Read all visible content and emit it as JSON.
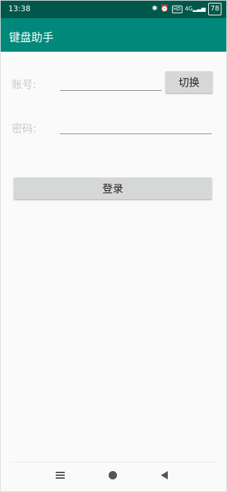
{
  "status_bar": {
    "time": "13:38",
    "icons": [
      "bluetooth-icon",
      "alarm-icon",
      "hd-icon",
      "signal-4g-icon"
    ],
    "battery": "78"
  },
  "app_bar": {
    "title": "键盘助手",
    "color": "#00897b",
    "status_color": "#00574b"
  },
  "form": {
    "account_label": "账号:",
    "account_value": "",
    "switch_button": "切换",
    "password_label": "密码:",
    "password_value": "",
    "login_button": "登录"
  },
  "nav_bar": {
    "icons": [
      "menu-icon",
      "home-icon",
      "back-icon"
    ]
  }
}
